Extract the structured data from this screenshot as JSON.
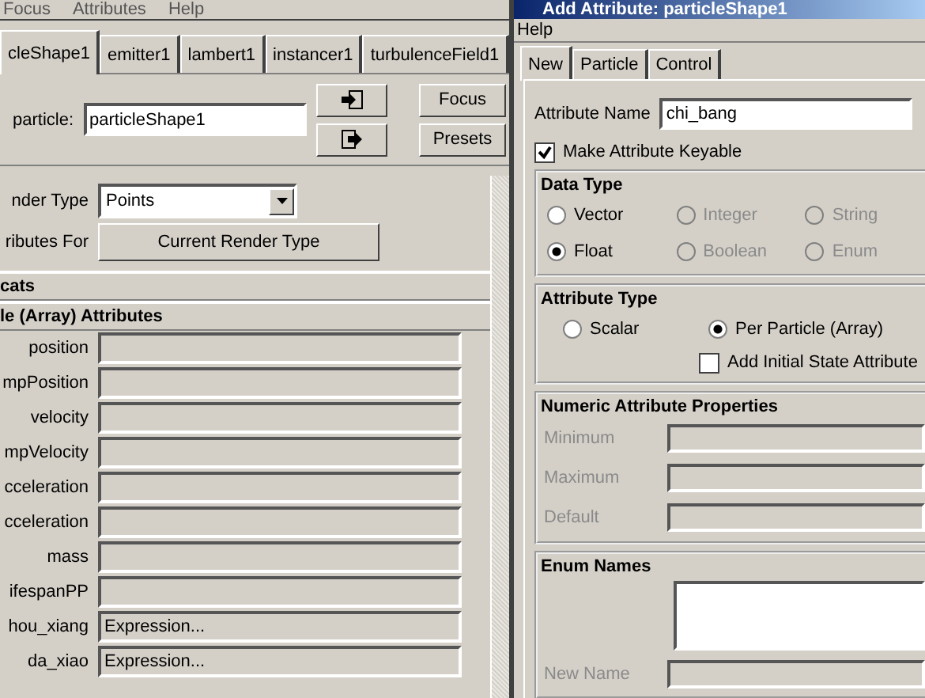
{
  "main_window": {
    "menu": [
      "Focus",
      "Attributes",
      "Help"
    ],
    "tabs": [
      {
        "label": "cleShape1",
        "selected": true
      },
      {
        "label": "emitter1",
        "selected": false
      },
      {
        "label": "lambert1",
        "selected": false
      },
      {
        "label": "instancer1",
        "selected": false
      },
      {
        "label": "turbulenceField1",
        "selected": false
      }
    ],
    "node_field": {
      "label": "particle:",
      "value": "particleShape1"
    },
    "buttons": [
      "Focus",
      "Presets"
    ],
    "render_type": {
      "label": "nder Type",
      "value": "Points"
    },
    "attributes_for": {
      "label": "ributes For",
      "button": "Current Render Type"
    },
    "sections": [
      {
        "title": "cats"
      },
      {
        "title": "le (Array) Attributes"
      }
    ],
    "attributes": [
      {
        "label": "position"
      },
      {
        "label": "mpPosition"
      },
      {
        "label": "velocity"
      },
      {
        "label": "mpVelocity"
      },
      {
        "label": "cceleration"
      },
      {
        "label": "cceleration"
      },
      {
        "label": "mass"
      },
      {
        "label": "ifespanPP"
      },
      {
        "label": "hou_xiang",
        "value": "Expression..."
      },
      {
        "label": "da_xiao",
        "value": "Expression..."
      }
    ]
  },
  "dialog": {
    "title": "Add Attribute: particleShape1",
    "menu": [
      "Help"
    ],
    "tabs": [
      {
        "label": "New",
        "selected": true
      },
      {
        "label": "Particle",
        "selected": false
      },
      {
        "label": "Control",
        "selected": false
      }
    ],
    "attribute_name": {
      "label": "Attribute Name",
      "value": "chi_bang"
    },
    "keyable": {
      "label": "Make Attribute Keyable",
      "checked": true
    },
    "data_type": {
      "title": "Data Type",
      "options": [
        {
          "label": "Vector",
          "selected": false,
          "disabled": false
        },
        {
          "label": "Integer",
          "selected": false,
          "disabled": true
        },
        {
          "label": "String",
          "selected": false,
          "disabled": true
        },
        {
          "label": "Float",
          "selected": true,
          "disabled": false
        },
        {
          "label": "Boolean",
          "selected": false,
          "disabled": true
        },
        {
          "label": "Enum",
          "selected": false,
          "disabled": true
        }
      ]
    },
    "attribute_type": {
      "title": "Attribute Type",
      "options": [
        {
          "label": "Scalar",
          "selected": false
        },
        {
          "label": "Per Particle (Array)",
          "selected": true
        }
      ],
      "initial_state": {
        "label": "Add Initial State Attribute",
        "checked": false
      }
    },
    "numeric": {
      "title": "Numeric Attribute Properties",
      "fields": [
        {
          "label": "Minimum",
          "disabled": true
        },
        {
          "label": "Maximum",
          "disabled": true
        },
        {
          "label": "Default",
          "disabled": true
        }
      ]
    },
    "enum_names": {
      "title": "Enum Names",
      "new_name_label": "New Name"
    }
  }
}
